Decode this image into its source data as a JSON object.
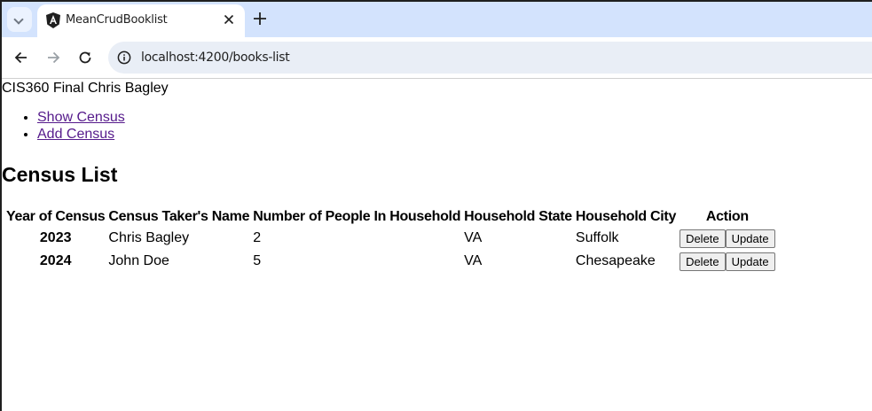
{
  "browser": {
    "tab_title": "MeanCrudBooklist",
    "url": "localhost:4200/books-list"
  },
  "page": {
    "app_title": "CIS360 Final Chris Bagley",
    "nav": [
      "Show Census",
      "Add Census"
    ],
    "heading": "Census List",
    "table": {
      "headers": [
        "Year of Census",
        "Census Taker's Name",
        "Number of People In Household",
        "Household State",
        "Household City",
        "Action"
      ],
      "rows": [
        {
          "year": "2023",
          "name": "Chris Bagley",
          "people": "2",
          "state": "VA",
          "city": "Suffolk"
        },
        {
          "year": "2024",
          "name": "John Doe",
          "people": "5",
          "state": "VA",
          "city": "Chesapeake"
        }
      ],
      "delete_label": "Delete",
      "update_label": "Update"
    }
  }
}
